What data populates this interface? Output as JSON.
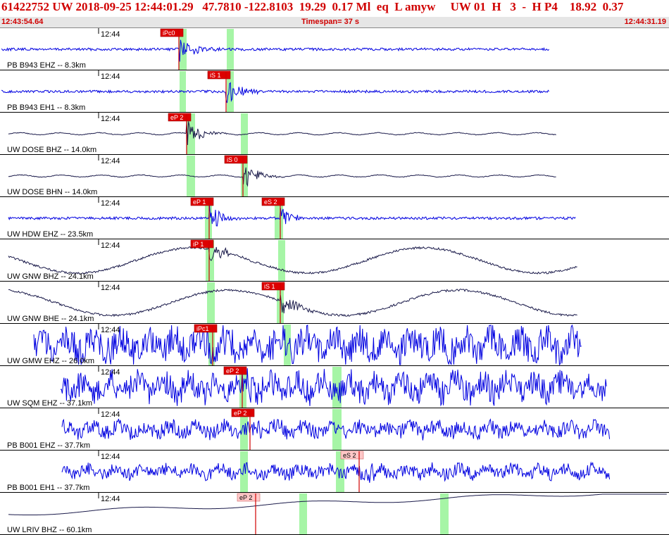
{
  "header": {
    "event_line": "61422752 UW 2018-09-25 12:44:01.29   47.7810 -122.8103  19.29  0.17 Ml  eq  L amyw     UW 01  H   3  -  H P4    18.92  0.37",
    "start_time": "12:43:54.64",
    "timespan": "Timespan=  37 s",
    "end_time": "12:44:31.19"
  },
  "colors": {
    "accent_red": "#d00000",
    "trace_blue": "#0000e0",
    "trace_dark": "#1a1a4a",
    "pick_fill": "#dd0000",
    "pick_pale": "#ffc8c8",
    "window_green": "#a6f5a6",
    "bar_gray": "#e6e6e6"
  },
  "panels": [
    {
      "label": "PB B943 EHZ -- 8.3km",
      "tick": "12:44",
      "style": "blue-noisy",
      "amp": 0.06,
      "pick": {
        "label": "iPc0",
        "pale": false
      }
    },
    {
      "label": "PB B943 EH1 -- 8.3km",
      "tick": "12:44",
      "style": "blue-noisy",
      "amp": 0.06,
      "pick": {
        "label": "iS 1",
        "pale": false
      }
    },
    {
      "label": "UW DOSE BHZ -- 14.0km",
      "tick": "12:44",
      "style": "dark-quiet",
      "amp": 0.04,
      "pick": {
        "label": "eP 2",
        "pale": false
      }
    },
    {
      "label": "UW DOSE BHN -- 14.0km",
      "tick": "12:44",
      "style": "dark-quiet",
      "amp": 0.04,
      "pick": {
        "label": "iS 0",
        "pale": false
      }
    },
    {
      "label": "UW HDW EHZ -- 23.5km",
      "tick": "12:44",
      "style": "blue-noisy",
      "amp": 0.06,
      "pick": {
        "label": "eP 1",
        "pale": false
      },
      "pick2": {
        "label": "eS 2",
        "pale": false
      }
    },
    {
      "label": "UW GNW BHZ -- 24.1km",
      "tick": "12:44",
      "style": "dark-slow",
      "amp": 0.3,
      "pick": {
        "label": "iP 1",
        "pale": false
      }
    },
    {
      "label": "UW GNW BHE -- 24.1km",
      "tick": "12:44",
      "style": "dark-slow",
      "amp": 0.3,
      "pick": {
        "label": "iS 1",
        "pale": false
      }
    },
    {
      "label": "UW GMW EHZ -- 26.0km",
      "tick": "12:44",
      "style": "blue-heavy",
      "amp": 0.7,
      "pick": {
        "label": "iPc1",
        "pale": false
      }
    },
    {
      "label": "UW SQM EHZ -- 37.1km",
      "tick": "12:44",
      "style": "blue-heavy",
      "amp": 0.6,
      "pick": {
        "label": "eP 2",
        "pale": false
      }
    },
    {
      "label": "PB B001 EHZ -- 37.7km",
      "tick": "12:44",
      "style": "blue-heavy",
      "amp": 0.35,
      "pick": {
        "label": "eP 2",
        "pale": false
      }
    },
    {
      "label": "PB B001 EH1 -- 37.7km",
      "tick": "12:44",
      "style": "blue-heavy",
      "amp": 0.3,
      "pick": {
        "label": "eS 2",
        "pale": true
      }
    },
    {
      "label": "UW LRIV BHZ -- 60.1km",
      "tick": "12:44",
      "style": "dark-drift",
      "amp": 0.5,
      "pick": {
        "label": "eP 2",
        "pale": true
      }
    }
  ]
}
